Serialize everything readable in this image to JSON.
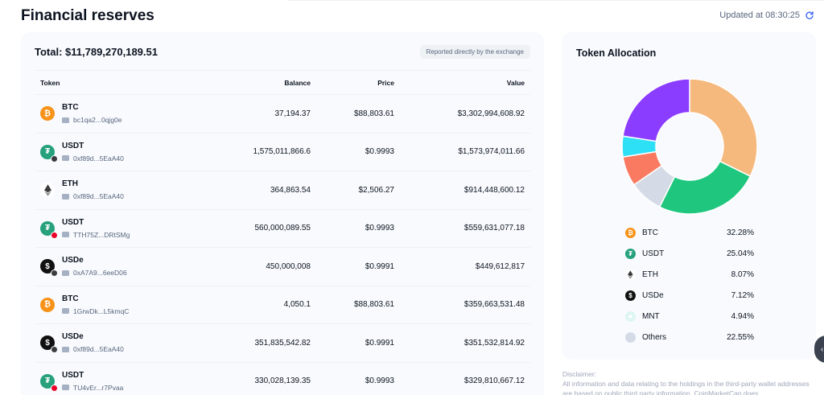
{
  "page": {
    "title": "Financial reserves",
    "updated": "Updated at 08:30:25"
  },
  "reserves": {
    "total": "Total: $11,789,270,189.51",
    "badge": "Reported directly by the exchange",
    "columns": {
      "token": "Token",
      "balance": "Balance",
      "price": "Price",
      "value": "Value"
    },
    "rows": [
      {
        "symbol": "BTC",
        "address": "bc1qa2...0qjg0e",
        "balance": "37,194.37",
        "price": "$88,803.61",
        "value": "$3,302,994,608.92",
        "icon": "btc-icon",
        "color": "#f7931a",
        "glyph": "₿",
        "sub": ""
      },
      {
        "symbol": "USDT",
        "address": "0xf89d...5EaA40",
        "balance": "1,575,011,866.6",
        "price": "$0.9993",
        "value": "$1,573,974,011.66",
        "icon": "usdt-icon",
        "color": "#26a17b",
        "glyph": "₮",
        "sub": "#3c3c3d"
      },
      {
        "symbol": "ETH",
        "address": "0xf89d...5EaA40",
        "balance": "364,863.54",
        "price": "$2,506.27",
        "value": "$914,448,600.12",
        "icon": "eth-icon",
        "color": "#ffffff",
        "glyph": "",
        "sub": ""
      },
      {
        "symbol": "USDT",
        "address": "TTH75Z...DRtSMg",
        "balance": "560,000,089.55",
        "price": "$0.9993",
        "value": "$559,631,077.18",
        "icon": "usdt-icon",
        "color": "#26a17b",
        "glyph": "₮",
        "sub": "#eb0029"
      },
      {
        "symbol": "USDe",
        "address": "0xA7A9...6eeD06",
        "balance": "450,000,008",
        "price": "$0.9991",
        "value": "$449,612,817",
        "icon": "usde-icon",
        "color": "#111111",
        "glyph": "$",
        "sub": "#3c3c3d"
      },
      {
        "symbol": "BTC",
        "address": "1GrwDk...L5kmqC",
        "balance": "4,050.1",
        "price": "$88,803.61",
        "value": "$359,663,531.48",
        "icon": "btc-icon",
        "color": "#f7931a",
        "glyph": "₿",
        "sub": ""
      },
      {
        "symbol": "USDe",
        "address": "0xf89d...5EaA40",
        "balance": "351,835,542.82",
        "price": "$0.9991",
        "value": "$351,532,814.92",
        "icon": "usde-icon",
        "color": "#111111",
        "glyph": "$",
        "sub": "#3c3c3d"
      },
      {
        "symbol": "USDT",
        "address": "TU4vEr...r7Pvaa",
        "balance": "330,028,139.35",
        "price": "$0.9993",
        "value": "$329,810,667.12",
        "icon": "usdt-icon",
        "color": "#26a17b",
        "glyph": "₮",
        "sub": "#eb0029"
      }
    ]
  },
  "allocation": {
    "title": "Token Allocation",
    "items": [
      {
        "name": "BTC",
        "pct": "32.28%",
        "value": 32.28,
        "color": "#f5b87d",
        "icon": "btc-icon",
        "iconColor": "#f7931a",
        "glyph": "₿"
      },
      {
        "name": "USDT",
        "pct": "25.04%",
        "value": 25.04,
        "color": "#1fc77e",
        "icon": "usdt-icon",
        "iconColor": "#26a17b",
        "glyph": "₮"
      },
      {
        "name": "ETH",
        "pct": "8.07%",
        "value": 8.07,
        "color": "#d5dbe6",
        "icon": "eth-icon",
        "iconColor": "#ffffff",
        "glyph": ""
      },
      {
        "name": "USDe",
        "pct": "7.12%",
        "value": 7.12,
        "color": "#f97a60",
        "icon": "usde-icon",
        "iconColor": "#111111",
        "glyph": "$"
      },
      {
        "name": "MNT",
        "pct": "4.94%",
        "value": 4.94,
        "color": "#2ee0f5",
        "icon": "mnt-icon",
        "iconColor": "#ffffff",
        "glyph": ""
      },
      {
        "name": "Others",
        "pct": "22.55%",
        "value": 22.55,
        "color": "#8b3dff",
        "icon": "others-icon",
        "iconColor": "#d5dbe6",
        "glyph": ""
      }
    ]
  },
  "disclaimer": {
    "heading": "Disclaimer:",
    "text": "All information and data relating to the holdings in the third-party wallet addresses are based on public third party information. CoinMarketCap does"
  }
}
